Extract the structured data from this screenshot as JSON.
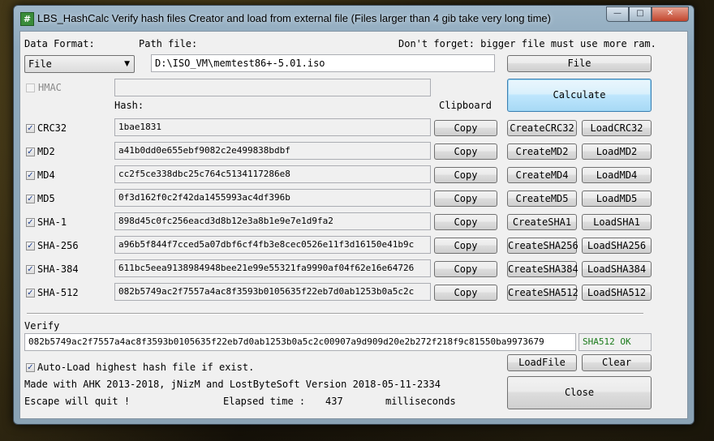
{
  "window": {
    "title": "LBS_HashCalc Verify hash files Creator and load from external file (Files larger than 4 gib take very long time)",
    "minimize_glyph": "—",
    "maximize_glyph": "□",
    "close_glyph": "✕"
  },
  "top": {
    "data_format_label": "Data Format:",
    "data_format_value": "File",
    "path_label": "Path file:",
    "warning": "Don't forget: bigger file must use more ram.",
    "path_value": "D:\\ISO_VM\\memtest86+-5.01.iso",
    "file_button": "File",
    "calculate_button": "Calculate",
    "hmac_label": "HMAC",
    "hash_header": "Hash:",
    "clipboard_header": "Clipboard"
  },
  "hashes": [
    {
      "name": "CRC32",
      "value": "1bae1831",
      "copy": "Copy",
      "create": "CreateCRC32",
      "load": "LoadCRC32",
      "checked": "✓"
    },
    {
      "name": "MD2",
      "value": "a41b0dd0e655ebf9082c2e499838bdbf",
      "copy": "Copy",
      "create": "CreateMD2",
      "load": "LoadMD2",
      "checked": "✓"
    },
    {
      "name": "MD4",
      "value": "cc2f5ce338dbc25c764c5134117286e8",
      "copy": "Copy",
      "create": "CreateMD4",
      "load": "LoadMD4",
      "checked": "✓"
    },
    {
      "name": "MD5",
      "value": "0f3d162f0c2f42da1455993ac4df396b",
      "copy": "Copy",
      "create": "CreateMD5",
      "load": "LoadMD5",
      "checked": "✓"
    },
    {
      "name": "SHA-1",
      "value": "898d45c0fc256eacd3d8b12e3a8b1e9e7e1d9fa2",
      "copy": "Copy",
      "create": "CreateSHA1",
      "load": "LoadSHA1",
      "checked": "✓"
    },
    {
      "name": "SHA-256",
      "value": "a96b5f844f7cced5a07dbf6cf4fb3e8cec0526e11f3d16150e41b9c",
      "copy": "Copy",
      "create": "CreateSHA256",
      "load": "LoadSHA256",
      "checked": "✓"
    },
    {
      "name": "SHA-384",
      "value": "611bc5eea9138984948bee21e99e55321fa9990af04f62e16e64726",
      "copy": "Copy",
      "create": "CreateSHA384",
      "load": "LoadSHA384",
      "checked": "✓"
    },
    {
      "name": "SHA-512",
      "value": "082b5749ac2f7557a4ac8f3593b0105635f22eb7d0ab1253b0a5c2c",
      "copy": "Copy",
      "create": "CreateSHA512",
      "load": "LoadSHA512",
      "checked": "✓"
    }
  ],
  "verify": {
    "label": "Verify",
    "value": "082b5749ac2f7557a4ac8f3593b0105635f22eb7d0ab1253b0a5c2c00907a9d909d20e2b272f218f9c81550ba9973679",
    "status": "SHA512 OK",
    "status_color": "#1a7a1a"
  },
  "bottom": {
    "autoload_checked": "✓",
    "autoload_label": "Auto-Load highest hash file if exist.",
    "loadfile_button": "LoadFile",
    "clear_button": "Clear",
    "credits": "Made with AHK 2013-2018, jNizM and LostByteSoft Version 2018-05-11-2334",
    "escape_text": "Escape will quit !",
    "elapsed_label": "Elapsed time :",
    "elapsed_value": "437",
    "elapsed_unit": "milliseconds",
    "close_button": "Close"
  }
}
